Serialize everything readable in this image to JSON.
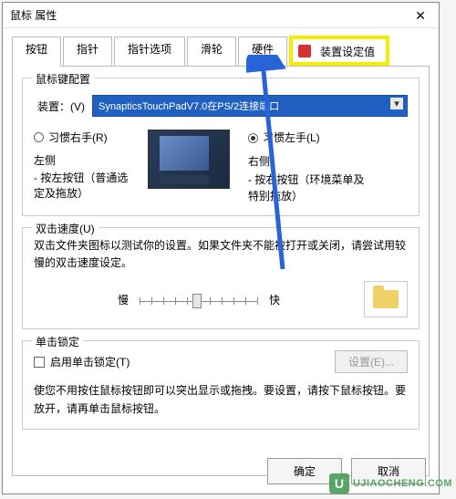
{
  "window": {
    "title": "鼠标 属性"
  },
  "tabs": [
    {
      "label": "按钮"
    },
    {
      "label": "指针"
    },
    {
      "label": "指针选项"
    },
    {
      "label": "滑轮"
    },
    {
      "label": "硬件"
    },
    {
      "label": "装置设定值"
    }
  ],
  "config": {
    "legend": "鼠标键配置",
    "device_label": "装置：(V)",
    "device_value": "SynapticsTouchPadV7.0在PS/2连接端口",
    "right_hand": "习惯右手(R)",
    "left_hand": "习惯左手(L)",
    "left_title": "左侧",
    "left_desc": "- 按左按钮（普通选定及拖放）",
    "right_title": "右侧",
    "right_desc": "- 按右按钮（环境菜单及特别拖放）"
  },
  "dblclick": {
    "legend": "双击速度(U)",
    "text": "双击文件夹图标以测试你的设置。如果文件夹不能被打开或关闭，请尝试用较慢的双击速度设定。",
    "slow": "慢",
    "fast": "快"
  },
  "clicklock": {
    "legend": "单击锁定",
    "enable": "启用单击锁定(T)",
    "settings_btn": "设置(E)...",
    "text": "使您不用按住鼠标按钮即可以突出显示或拖拽。要设置，请按下鼠标按钮。要放开，请再单击鼠标按钮。"
  },
  "buttons": {
    "ok": "确定",
    "cancel": "取消"
  },
  "watermark": {
    "text": "UJIAOCHENG.COM"
  }
}
